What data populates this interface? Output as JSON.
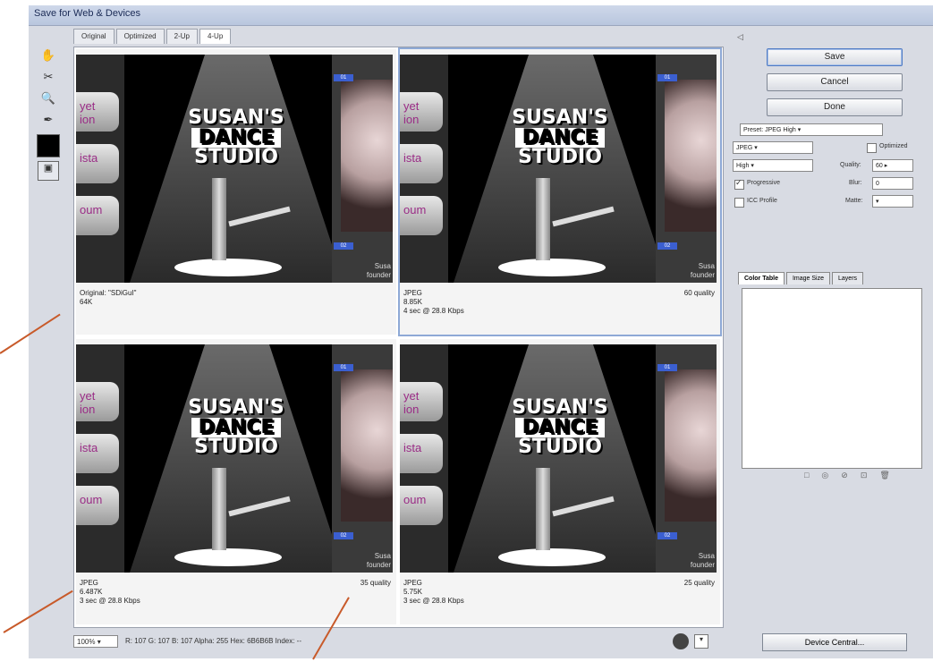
{
  "window": {
    "title": "Save for Web & Devices"
  },
  "tabs": [
    "Original",
    "Optimized",
    "2-Up",
    "4-Up"
  ],
  "active_tab": "4-Up",
  "toolbox": [
    "hand-icon",
    "slice-select-icon",
    "zoom-icon",
    "eyedropper-icon",
    "color-swatch",
    "toggle-slices-icon"
  ],
  "image_text": {
    "title_line1": "SUSAN'S",
    "title_line2": "DANCE",
    "title_line3": "STUDIO",
    "pill1": "yet\nion",
    "pill2": "ista",
    "pill3": "oum",
    "caption": "Susa\nfounder"
  },
  "panes": [
    {
      "line1": "Original: \"SDiGuI\"",
      "line2": "64K",
      "line3": "",
      "quality": ""
    },
    {
      "line1": "JPEG",
      "line2": "8.85K",
      "line3": "4 sec @ 28.8 Kbps",
      "quality": "60 quality"
    },
    {
      "line1": "JPEG",
      "line2": "6.487K",
      "line3": "3 sec @ 28.8 Kbps",
      "quality": "35 quality"
    },
    {
      "line1": "JPEG",
      "line2": "5.75K",
      "line3": "3 sec @ 28.8 Kbps",
      "quality": "25 quality"
    }
  ],
  "status": {
    "zoom": "100%",
    "readout": "R: 107   G: 107   B: 107   Alpha: 255   Hex: 6B6B6B   Index: --"
  },
  "buttons": {
    "save": "Save",
    "cancel": "Cancel",
    "done": "Done",
    "device_central": "Device Central..."
  },
  "settings": {
    "preset_label": "Preset: JPEG High",
    "format": "JPEG",
    "compression": "High",
    "quality_label": "Quality:",
    "quality_value": "60",
    "blur_label": "Blur:",
    "blur_value": "0",
    "matte_label": "Matte:",
    "optimized_label": "Optimized",
    "progressive_label": "Progressive",
    "icc_label": "ICC Profile",
    "progressive_checked": true,
    "optimized_checked": false,
    "icc_checked": false
  },
  "color_table": {
    "tabs": [
      "Color Table",
      "Image Size",
      "Layers"
    ]
  },
  "colors": {
    "selection": "#8ea9d6",
    "callout": "#c85a2a",
    "badge": "#3b5fd0"
  }
}
